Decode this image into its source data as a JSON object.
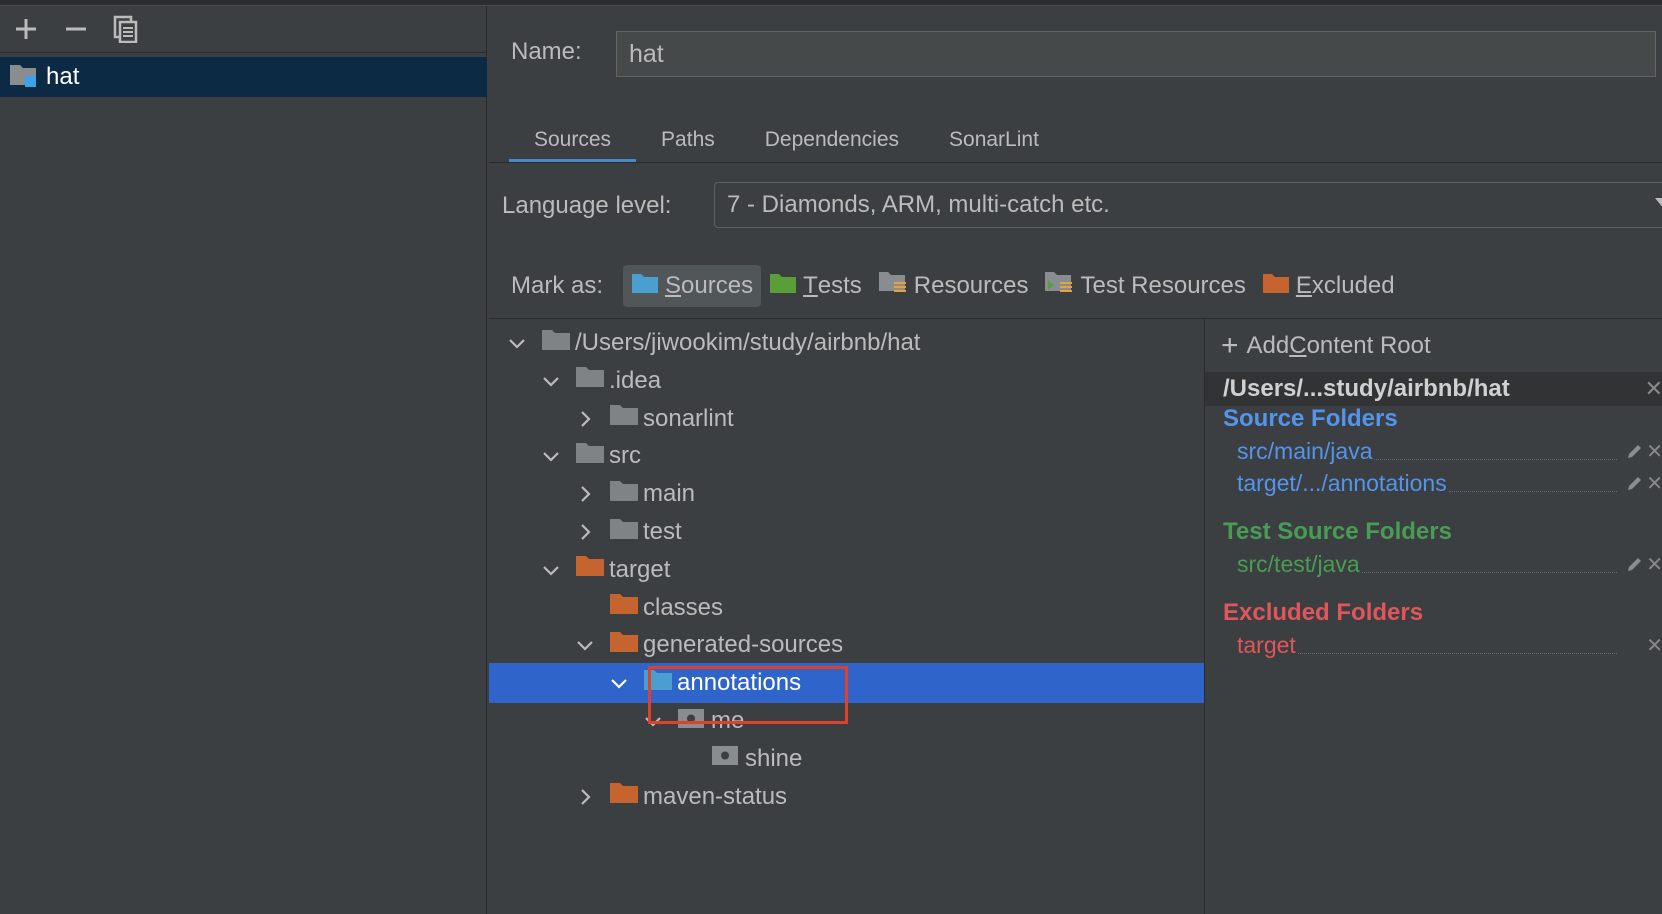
{
  "left_toolbar": {
    "icons": [
      "plus-icon",
      "minus-icon",
      "copy-icon"
    ]
  },
  "module": {
    "name": "hat"
  },
  "name_field": {
    "label": "Name:",
    "value": "hat"
  },
  "tabs": [
    {
      "label": "Sources",
      "active": true
    },
    {
      "label": "Paths",
      "active": false
    },
    {
      "label": "Dependencies",
      "active": false
    },
    {
      "label": "SonarLint",
      "active": false
    }
  ],
  "language_level": {
    "label": "Language level:",
    "value": "7 - Diamonds, ARM, multi-catch etc."
  },
  "mark_as": {
    "label": "Mark as:",
    "buttons": [
      {
        "mnemonic": "S",
        "rest": "ources",
        "active": true,
        "color": "#4a9fd0"
      },
      {
        "mnemonic": "T",
        "rest": "ests",
        "active": false,
        "color": "#5a9e3a"
      },
      {
        "mnemonic": "",
        "rest": "Resources",
        "active": false,
        "color": "#8a8d90"
      },
      {
        "mnemonic": "",
        "rest": "Test Resources",
        "active": false,
        "color": "#8a8d90"
      },
      {
        "mnemonic": "E",
        "rest": "xcluded",
        "active": false,
        "color": "#c5642e"
      }
    ]
  },
  "tree": [
    {
      "label": "/Users/jiwookim/study/airbnb/hat",
      "level": 0,
      "expanded": true,
      "type": "plain"
    },
    {
      "label": ".idea",
      "level": 1,
      "expanded": true,
      "type": "plain"
    },
    {
      "label": "sonarlint",
      "level": 2,
      "expanded": false,
      "type": "plain"
    },
    {
      "label": "src",
      "level": 1,
      "expanded": true,
      "type": "plain"
    },
    {
      "label": "main",
      "level": 2,
      "expanded": false,
      "type": "plain"
    },
    {
      "label": "test",
      "level": 2,
      "expanded": false,
      "type": "plain"
    },
    {
      "label": "target",
      "level": 1,
      "expanded": true,
      "type": "excluded"
    },
    {
      "label": "classes",
      "level": 2,
      "expanded": null,
      "type": "excluded"
    },
    {
      "label": "generated-sources",
      "level": 2,
      "expanded": true,
      "type": "excluded"
    },
    {
      "label": "annotations",
      "level": 3,
      "expanded": true,
      "type": "source",
      "selected": true
    },
    {
      "label": "me",
      "level": 4,
      "expanded": true,
      "type": "package"
    },
    {
      "label": "shine",
      "level": 5,
      "expanded": null,
      "type": "package"
    },
    {
      "label": "maven-status",
      "level": 2,
      "expanded": false,
      "type": "excluded"
    }
  ],
  "content_roots": {
    "add_label_pre": "Add ",
    "add_label_mnemonic": "C",
    "add_label_post": "ontent Root",
    "root_path": "/Users/...study/airbnb/hat",
    "source_folders_title": "Source Folders",
    "source_folders": [
      "src/main/java",
      "target/.../annotations"
    ],
    "test_folders_title": "Test Source Folders",
    "test_folders": [
      "src/test/java"
    ],
    "excluded_title": "Excluded Folders",
    "excluded_folders": [
      "target"
    ],
    "colors": {
      "source": "#5394ec",
      "test": "#499c54",
      "excluded": "#e0565b"
    }
  }
}
